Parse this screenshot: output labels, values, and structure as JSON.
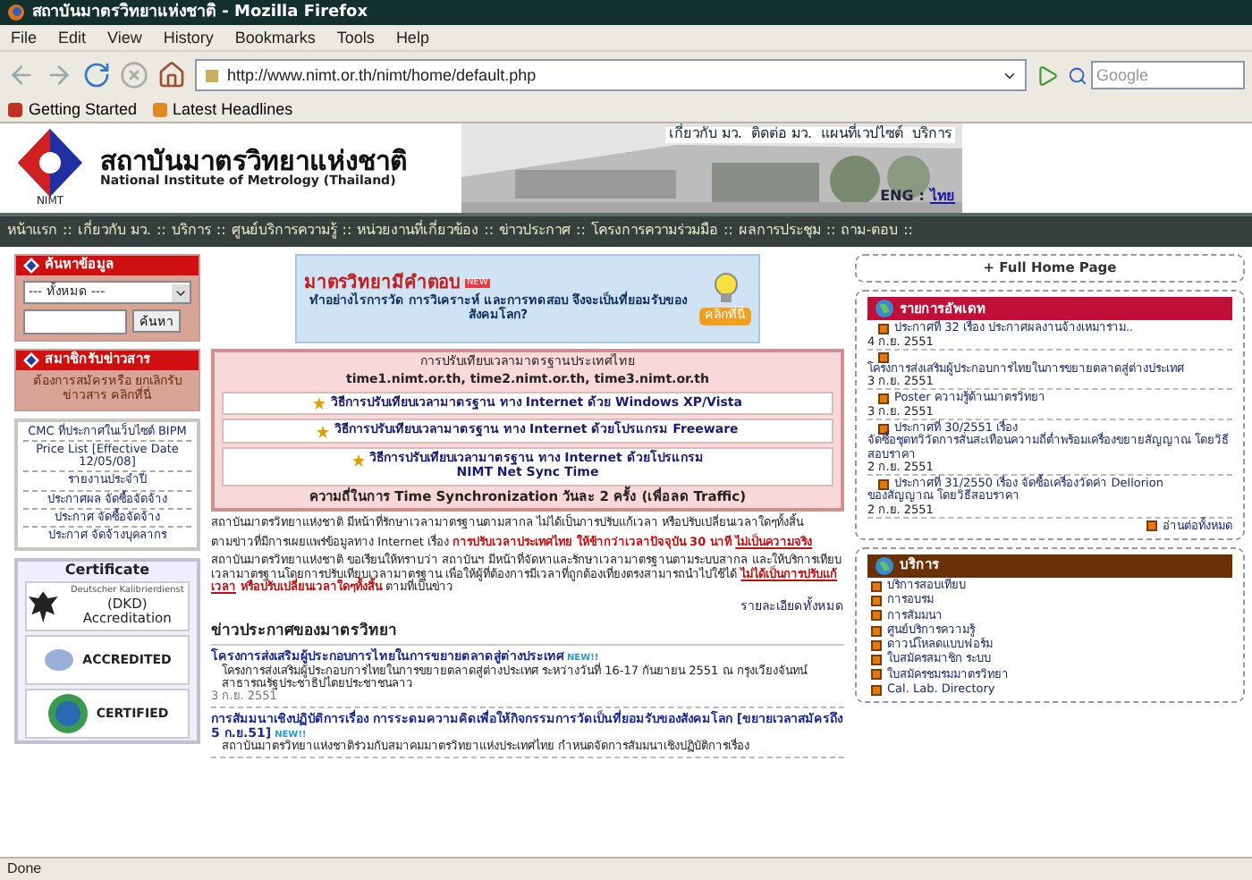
{
  "window": {
    "title": "สถาบันมาตรวิทยาแห่งชาติ - Mozilla Firefox"
  },
  "menu": [
    "File",
    "Edit",
    "View",
    "History",
    "Bookmarks",
    "Tools",
    "Help"
  ],
  "address": "http://www.nimt.or.th/nimt/home/default.php",
  "search": {
    "placeholder": "Google"
  },
  "bookmarks": [
    "Getting Started",
    "Latest Headlines"
  ],
  "header": {
    "logo_caption": "NIMT",
    "title": "สถาบันมาตรวิทยาแห่งชาติ",
    "subtitle": "National Institute of Metrology (Thailand)",
    "top_links": [
      "เกี่ยวกับ มว.",
      "ติดต่อ มว.",
      "แผนที่เวปไซต์",
      "บริการ"
    ],
    "languages": [
      {
        "label": "ENG",
        "selected": false
      },
      {
        "label": "ไทย",
        "selected": true
      }
    ],
    "language_separator": ":"
  },
  "nav": [
    "หน้าแรก",
    "เกี่ยวกับ มว.",
    "บริการ",
    "ศูนย์บริการความรู้",
    "หน่วยงานที่เกี่ยวข้อง",
    "ข่าวประกาศ",
    "โครงการความร่วมมือ",
    "ผลการประชุม",
    "ถาม-ตอบ"
  ],
  "nav_separator": "::",
  "sidebar": {
    "search_title": "ค้นหาข้อมูล",
    "scope": "--- ทั้งหมด ---",
    "search_button": "ค้นหา",
    "newsletter_title": "สมาชิกรับข่าวสาร",
    "newsletter_text": "ต้องการสมัครหรือ ยกเลิกรับข่าวสาร คลิกที่นี่",
    "links": [
      "CMC ที่ประกาศในเว็บไซต์ BIPM",
      "Price List [Effective Date 12/05/08]",
      "รายงานประจำปี",
      "ประกาศผล จัดซื้อจัดจ้าง",
      "ประกาศ จัดซื้อจัดจ้าง",
      "ประกาศ จัดจ้างบุคลากร"
    ],
    "certificate_title": "Certificate",
    "certificates": [
      {
        "kind": "dkd",
        "note": "Deutscher Kalibrierdienst",
        "caption": "(DKD) Accreditation"
      },
      {
        "kind": "accredited",
        "caption": "ACCREDITED"
      },
      {
        "kind": "certified",
        "caption": "CERTIFIED"
      }
    ]
  },
  "promo": {
    "title": "มาตรวิทยามีคำตอบ",
    "badge": "NEW",
    "text": "ทำอย่างไรการวัด การวิเคราะห์ และการทดสอบ จึงจะเป็นที่ยอมรับของสังคมโลก?",
    "button": "คลิกที่นี่"
  },
  "time_box": {
    "title": "การปรับเทียบเวลามาตรฐานประเทศไทย",
    "servers": "time1.nimt.or.th, time2.nimt.or.th, time3.nimt.or.th",
    "links": [
      {
        "text": "วิธีการปรับเทียบเวลามาตรฐาน ทาง Internet ด้วย Windows XP/Vista"
      },
      {
        "text": "วิธีการปรับเทียบเวลามาตรฐาน ทาง Internet ด้วยโปรแกรม Freeware"
      },
      {
        "text": "วิธีการปรับเทียบเวลามาตรฐาน ทาง Internet ด้วยโปรแกรม",
        "sub": "NIMT Net Sync Time"
      }
    ],
    "footer": "ความถี่ในการ Time Synchronization วันละ 2 ครั้ง (เพื่อลด Traffic)"
  },
  "notice": [
    [
      {
        "kind": "plain",
        "text": "สถาบันมาตรวิทยาแห่งชาติ มีหน้าที่รักษาเวลามาตรฐานตามสากล ไม่ได้เป็นการปรับแก้เวลา หรือปรับเปลี่ยนเวลาใดๆทั้งสิ้น"
      }
    ],
    [
      {
        "kind": "plain",
        "text": "ตามข่าวที่มีการเผยแพร่ข้อมูลทาง Internet เรื่อง "
      },
      {
        "kind": "alert",
        "text": "การปรับเวลาประเทศไทย ให้ช้ากว่าเวลาปัจจุบัน 30 นาที "
      },
      {
        "kind": "alert_link",
        "text": "ไม่เป็นความจริง"
      }
    ],
    [
      {
        "kind": "plain",
        "text": "สถาบันมาตรวิทยาแห่งชาติ ขอเรียนให้ทราบว่า สถาบันฯ มีหน้าที่จัดหาและรักษาเวลามาตรฐานตามระบบสากล และให้บริการเทียบเวลามาตรฐานโดยการปรับเทียบเวลามาตรฐาน เพื่อให้ผู้ที่ต้องการมีเวลาที่ถูกต้องเที่ยงตรงสามารถนำไปใช้ได้ "
      },
      {
        "kind": "alert_link",
        "text": "ไม่ได้เป็นการปรับแก้เวลา"
      },
      {
        "kind": "alert",
        "text": " หรือปรับเปลี่ยนเวลาใดๆทั้งสิ้น"
      },
      {
        "kind": "plain",
        "text": " ตามที่เป็นข่าว"
      }
    ]
  ],
  "notice_more": "รายละเอียดทั้งหมด",
  "news": {
    "title": "ข่าวประกาศของมาตรวิทยา",
    "items": [
      {
        "title": "โครงการส่งเสริมผู้ประกอบการไทยในการขยายตลาดสู่ต่างประเทศ",
        "badge": "NEW!!",
        "body": "โครงการส่งเสริมผู้ประกอบการไทยในการขยายตลาดสู่ต่างประเทศ ระหว่างวันที่ 16-17 กันยายน 2551 ณ กรุงเวียงจันทน์ สาธารณรัฐประชาธิปไตยประชาชนลาว",
        "date": "3 ก.ย. 2551"
      },
      {
        "title": "การสัมมนาเชิงปฏิบัติการเรื่อง การระดมความคิดเพื่อให้กิจกรรมการวัดเป็นที่ยอมรับของสังคมโลก [ขยายเวลาสมัครถึง 5 ก.ย.51]",
        "badge": "NEW!!",
        "body": "สถาบันมาตรวิทยาแห่งชาติร่วมกับสมาคมมาตรวิทยาแห่งประเทศไทย กำหนดจัดการสัมมนาเชิงปฏิบัติการเรื่อง"
      }
    ]
  },
  "full_home": "+ Full Home Page",
  "updates": {
    "title": "รายการอัพเดท",
    "items": [
      {
        "lead": "ประกาศที่ 32 เรื่อง ประกาศผลงานจ้างเหมาราม..",
        "date": "4 ก.ย. 2551"
      },
      {
        "text": "โครงการส่งเสริมผู้ประกอบการไทยในการขยายตลาดสู่ต่างประเทศ",
        "date": "3 ก.ย. 2551"
      },
      {
        "lead": "Poster ความรู้ด้านมาตรวิทยา",
        "date": "3 ก.ย. 2551"
      },
      {
        "lead": "ประกาศที่ 30/2551 เรื่อง",
        "text": "จัดซื้อชุดทวิวัดการสั่นสะเทือนความถี่ต่ำพร้อมเครื่องขยายสัญญาณ โดยวิธีสอบราคา",
        "date": "2 ก.ย. 2551"
      },
      {
        "lead": "ประกาศที่ 31/2550 เรื่อง จัดซื้อเครื่องวัดค่า Dellorion",
        "text": "ของสัญญาณ โดยวิธีสอบราคา",
        "date": "2 ก.ย. 2551"
      }
    ],
    "more": "อ่านต่อทั้งหมด"
  },
  "services": {
    "title": "บริการ",
    "items": [
      "บริการสอบเทียบ",
      "การอบรม",
      "การสัมมนา",
      "ศูนย์บริการความรู้",
      "ดาวน์โหลดแบบฟอร์ม",
      "ใบสมัครสมาชิก ระบบ",
      "ใบสมัครชมรมมาตรวิทยา",
      "Cal. Lab. Directory"
    ]
  },
  "status_bar": "Done"
}
